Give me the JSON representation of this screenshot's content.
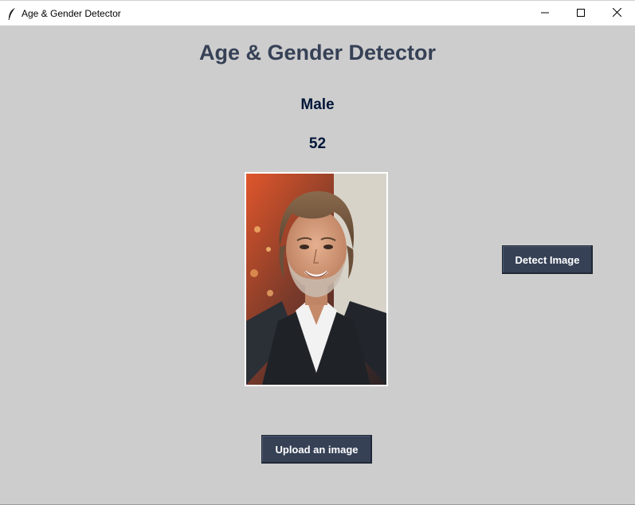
{
  "window": {
    "title": "Age & Gender Detector",
    "controls": [
      "minimize-icon",
      "maximize-icon",
      "close-icon"
    ]
  },
  "main": {
    "heading": "Age & Gender Detector",
    "gender": "Male",
    "age": "52",
    "photo_alt": "Uploaded portrait photo",
    "detect_button": "Detect Image",
    "upload_button": "Upload an image"
  },
  "colors": {
    "background": "#cdcdcd",
    "heading": "#364156",
    "result_text": "#011638",
    "button_bg": "#364156",
    "button_text": "#ffffff"
  },
  "icons": {
    "app": "feather-icon",
    "minimize": "minimize-icon",
    "maximize": "maximize-icon",
    "close": "close-icon"
  }
}
